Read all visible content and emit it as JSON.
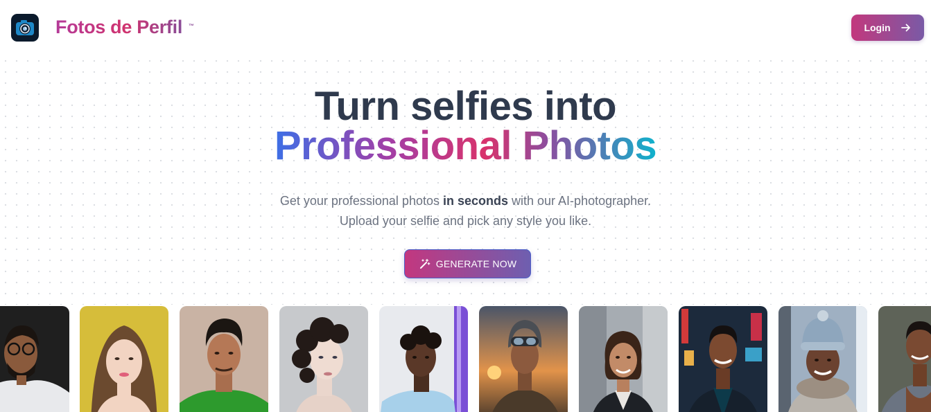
{
  "header": {
    "brand": "Fotos de Perfil",
    "trademark": "™",
    "login_label": "Login",
    "login_icon": "arrow-right-icon"
  },
  "hero": {
    "line1": "Turn selfies into",
    "line2": "Professional Photos",
    "subtitle_part1": "Get your professional photos ",
    "subtitle_bold": "in seconds",
    "subtitle_part2": " with our AI-photographer.",
    "subtitle_line2": "Upload your selfie and pick any style you like.",
    "cta_label": "GENERATE NOW",
    "cta_icon": "magic-wand-icon"
  },
  "colors": {
    "brand_pink": "#c2387d",
    "brand_purple": "#7a5aa6",
    "heading": "#2f3a4d",
    "logo_bg": "#0b1a2c"
  },
  "gallery": [
    {
      "name": "portrait-man-glasses"
    },
    {
      "name": "portrait-woman-yellow"
    },
    {
      "name": "portrait-man-green-shirt"
    },
    {
      "name": "portrait-woman-curls"
    },
    {
      "name": "portrait-young-man-curly"
    },
    {
      "name": "portrait-aviator-sunset"
    },
    {
      "name": "portrait-businesswoman"
    },
    {
      "name": "portrait-man-city-night"
    },
    {
      "name": "portrait-woman-winter-hat"
    },
    {
      "name": "portrait-man-partial"
    }
  ]
}
